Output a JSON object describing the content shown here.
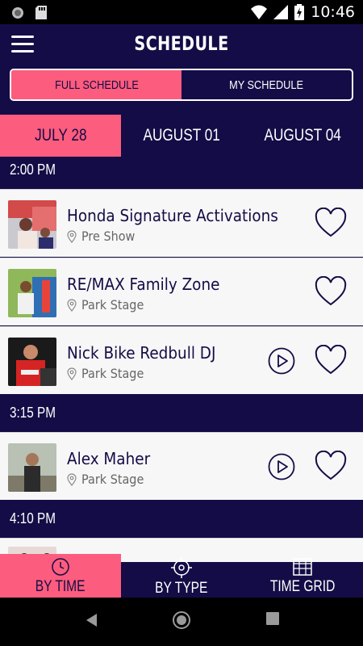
{
  "status_bar": {
    "time": "10:46"
  },
  "header": {
    "title": "SCHEDULE"
  },
  "schedule_toggle": {
    "options": [
      "FULL SCHEDULE",
      "MY SCHEDULE"
    ],
    "selected": "FULL SCHEDULE"
  },
  "dates": {
    "items": [
      "JULY 28",
      "AUGUST 01",
      "AUGUST 04"
    ],
    "selected": "JULY 28"
  },
  "groups": [
    {
      "time": "2:00 PM",
      "events": [
        {
          "title": "Honda Signature Activations",
          "location": "Pre Show",
          "has_play": false,
          "thumb_icon": "event-photo"
        },
        {
          "title": "RE/MAX Family Zone",
          "location": "Park Stage",
          "has_play": false,
          "thumb_icon": "event-photo"
        },
        {
          "title": "Nick Bike Redbull DJ",
          "location": "Park Stage",
          "has_play": true,
          "thumb_icon": "event-photo"
        }
      ]
    },
    {
      "time": "3:15 PM",
      "events": [
        {
          "title": "Alex Maher",
          "location": "Park Stage",
          "has_play": true,
          "thumb_icon": "event-photo"
        }
      ]
    },
    {
      "time": "4:10 PM",
      "events": []
    }
  ],
  "bottom_nav": {
    "items": [
      {
        "label": "BY TIME",
        "icon": "clock-icon"
      },
      {
        "label": "BY TYPE",
        "icon": "target-icon"
      },
      {
        "label": "TIME GRID",
        "icon": "grid-icon"
      }
    ],
    "selected": "BY TIME"
  },
  "colors": {
    "background": "#140c46",
    "accent": "#fc5c7d",
    "row": "#f7f7f7",
    "text_dark": "#140c46"
  }
}
